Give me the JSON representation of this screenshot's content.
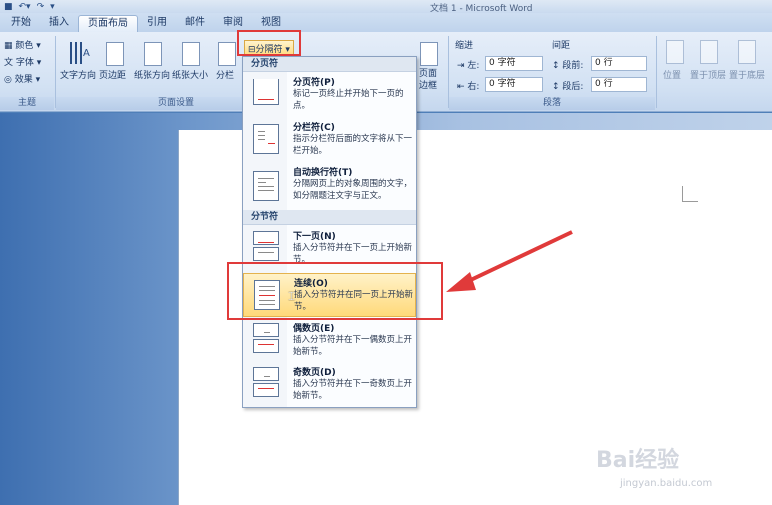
{
  "window": {
    "title": "文档 1 - Microsoft Word"
  },
  "qat": {
    "save_icon": "save-icon",
    "undo_icon": "undo-icon",
    "redo_icon": "redo-icon"
  },
  "tabs": [
    {
      "label": "开始"
    },
    {
      "label": "插入"
    },
    {
      "label": "页面布局",
      "active": true
    },
    {
      "label": "引用"
    },
    {
      "label": "邮件"
    },
    {
      "label": "审阅"
    },
    {
      "label": "视图"
    }
  ],
  "ribbon": {
    "theme": {
      "colors": "颜色",
      "fonts": "字体",
      "effects": "效果",
      "group_label": "主题"
    },
    "page_setup": {
      "text_direction": "文字方向",
      "margins": "页边距",
      "orientation": "纸张方向",
      "size": "纸张大小",
      "columns": "分栏",
      "breaks": "分隔符",
      "group_label": "页面设置"
    },
    "page_bg": {
      "borders": "页面\n边框"
    },
    "paragraph": {
      "indent_label": "缩进",
      "spacing_label": "间距",
      "left_label": "左:",
      "right_label": "右:",
      "before_label": "段前:",
      "after_label": "段后:",
      "left_value": "0 字符",
      "right_value": "0 字符",
      "before_value": "0 行",
      "after_value": "0 行",
      "group_label": "段落"
    },
    "arrange": {
      "position": "位置",
      "bring_front": "置于顶层",
      "send_back": "置于底层"
    }
  },
  "menu": {
    "page_breaks_header": "分页符",
    "section_breaks_header": "分节符",
    "items": [
      {
        "title": "分页符(P)",
        "desc": "标记一页终止并开始下一页的点。"
      },
      {
        "title": "分栏符(C)",
        "desc": "指示分栏符后面的文字将从下一栏开始。"
      },
      {
        "title": "自动换行符(T)",
        "desc": "分隔网页上的对象周围的文字，如分隔题注文字与正文。"
      },
      {
        "title": "下一页(N)",
        "desc": "插入分节符并在下一页上开始新节。"
      },
      {
        "title": "连续(O)",
        "desc": "插入分节符并在同一页上开始新节。"
      },
      {
        "title": "偶数页(E)",
        "desc": "插入分节符并在下一偶数页上开始新节。"
      },
      {
        "title": "奇数页(D)",
        "desc": "插入分节符并在下一奇数页上开始新节。"
      }
    ]
  },
  "watermark": {
    "brand": "Bai经验",
    "url": "jingyan.baidu.com"
  },
  "colors": {
    "highlight_red": "#e03a3a",
    "hover_orange": "#ffd97a"
  }
}
